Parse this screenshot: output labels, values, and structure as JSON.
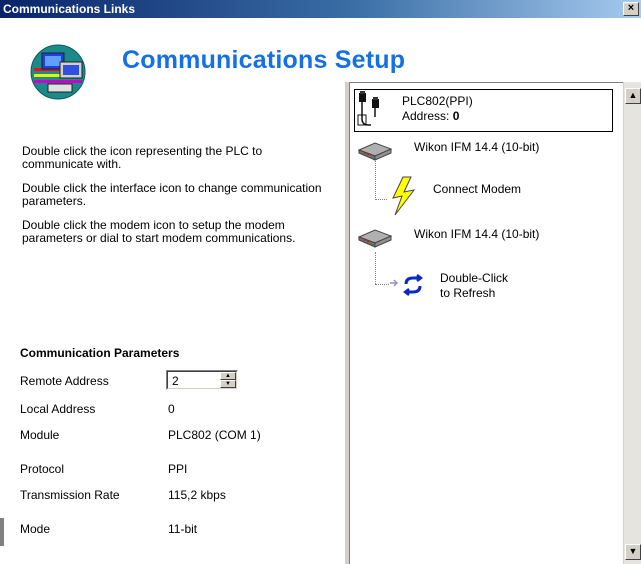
{
  "window": {
    "title": "Communications Links",
    "close_label": "×"
  },
  "header": {
    "title": "Communications Setup"
  },
  "instructions": [
    "Double click the icon representing the PLC to communicate with.",
    "Double click the interface icon to change communication parameters.",
    "Double click the modem icon to setup the modem parameters or dial to start modem communications."
  ],
  "params": {
    "title": "Communication Parameters",
    "remote_address": {
      "label": "Remote Address",
      "value": "2"
    },
    "local_address": {
      "label": "Local Address",
      "value": "0"
    },
    "module": {
      "label": "Module",
      "value": "PLC802 (COM 1)"
    },
    "protocol": {
      "label": "Protocol",
      "value": "PPI"
    },
    "rate": {
      "label": "Transmission Rate",
      "value": "115,2 kbps"
    },
    "mode": {
      "label": "Mode",
      "value": "11-bit"
    }
  },
  "tree": {
    "plc": {
      "name": "PLC802(PPI)",
      "address_label": "Address: ",
      "address_value": "0"
    },
    "modem1": {
      "label": "Wikon IFM 14.4 (10-bit)"
    },
    "connect": {
      "label": "Connect Modem"
    },
    "modem2": {
      "label": "Wikon IFM 14.4 (10-bit)"
    },
    "refresh": {
      "line1": "Double-Click",
      "line2": "to Refresh"
    }
  },
  "colors": {
    "accent": "#1470e6",
    "titlebar": "#0a246a"
  },
  "icons": [
    "plc-icon",
    "modem-icon",
    "lightning-icon",
    "refresh-icon",
    "network-logo-icon"
  ]
}
